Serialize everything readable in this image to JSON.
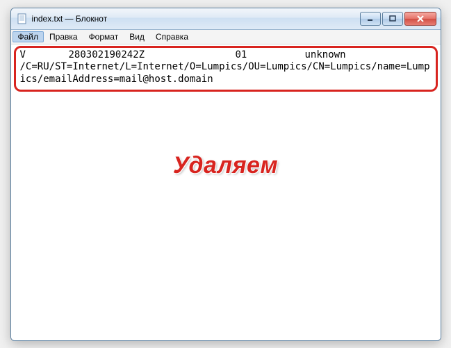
{
  "window": {
    "title": "index.txt — Блокнот"
  },
  "menubar": {
    "file": "Файл",
    "edit": "Правка",
    "format": "Формат",
    "view": "Вид",
    "help": "Справка"
  },
  "content": {
    "col_v": "V",
    "col_date": "280302190242Z",
    "col_serial": "01",
    "col_status": "unknown",
    "subject": "/C=RU/ST=Internet/L=Internet/O=Lumpics/OU=Lumpics/CN=Lumpics/name=Lumpics/emailAddress=mail@host.domain"
  },
  "annotation": "Удаляем"
}
